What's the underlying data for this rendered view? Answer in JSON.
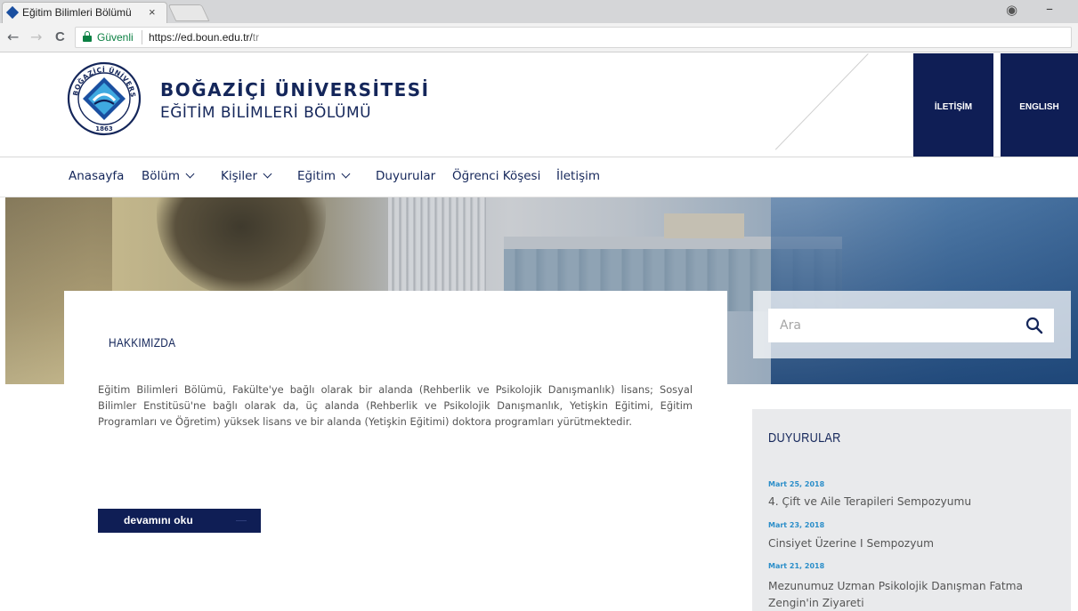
{
  "browser": {
    "tab_title": "Eğitim Bilimleri Bölümü",
    "tab_close": "×",
    "secure_label": "Güvenli",
    "url_host": "https://ed.boun.edu.tr/",
    "url_path": "tr",
    "back": "←",
    "forward": "→",
    "reload": "C",
    "profile_icon": "profile-icon",
    "minimize": "–"
  },
  "header": {
    "title": "BOĞAZİÇİ ÜNİVERSİTESİ",
    "subtitle": "EĞİTİM BİLİMLERİ BÖLÜMÜ",
    "logo_top_text": "BOĞAZİÇİ ÜNİVERSİTESİ",
    "logo_year": "1863",
    "contact_button": "İLETİŞİM",
    "english_button": "ENGLISH"
  },
  "nav": {
    "items": [
      {
        "label": "Anasayfa",
        "dropdown": false
      },
      {
        "label": "Bölüm",
        "dropdown": true
      },
      {
        "label": "Kişiler",
        "dropdown": true
      },
      {
        "label": "Eğitim",
        "dropdown": true
      },
      {
        "label": "Duyurular",
        "dropdown": false
      },
      {
        "label": "Öğrenci Köşesi",
        "dropdown": false
      },
      {
        "label": "İletişim",
        "dropdown": false
      }
    ]
  },
  "about": {
    "heading": "HAKKIMIZDA",
    "text": "Eğitim Bilimleri Bölümü, Fakülte'ye bağlı olarak bir alanda (Rehberlik ve Psikolojik Danışmanlık) lisans; Sosyal Bilimler Enstitüsü'ne bağlı olarak da, üç alanda (Rehberlik ve Psikolojik Danışmanlık, Yetişkin Eğitimi, Eğitim Programları ve Öğretim) yüksek lisans ve bir alanda (Yetişkin Eğitimi) doktora programları yürütmektedir.",
    "more_button": "devamını oku"
  },
  "search": {
    "placeholder": "Ara",
    "icon": "search-icon"
  },
  "announcements": {
    "heading": "DUYURULAR",
    "items": [
      {
        "date": "Mart 25, 2018",
        "title": "4. Çift ve Aile Terapileri Sempozyumu"
      },
      {
        "date": "Mart 23, 2018",
        "title": "Cinsiyet Üzerine I Sempozyum"
      },
      {
        "date": "Mart 21, 2018",
        "title": "Mezunumuz Uzman Psikolojik Danışman Fatma Zengin'in Ziyareti"
      }
    ]
  },
  "colors": {
    "brand_navy": "#0f1e55",
    "text_navy": "#14265a",
    "date_blue": "#2b8ec9",
    "secure_green": "#0b8043"
  }
}
